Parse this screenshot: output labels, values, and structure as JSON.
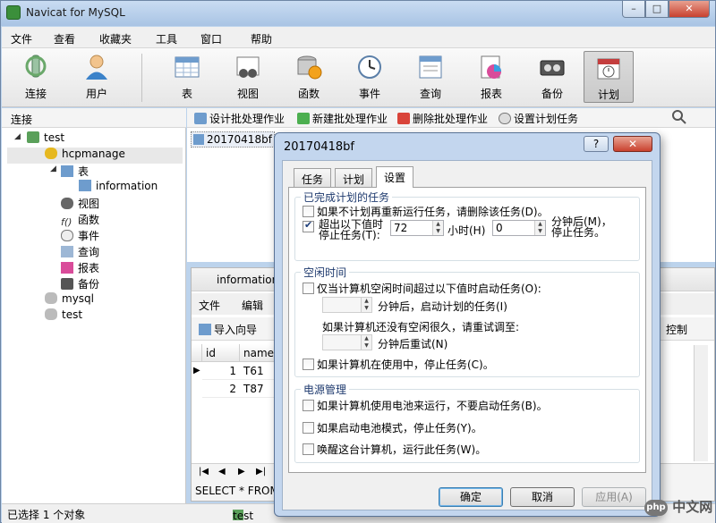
{
  "window": {
    "title": "Navicat for MySQL",
    "min": "–",
    "max": "□",
    "close": "✕"
  },
  "menu": [
    "文件",
    "查看",
    "收藏夹",
    "工具",
    "窗口",
    "帮助"
  ],
  "toolbar": {
    "connect": "连接",
    "user": "用户",
    "table": "表",
    "view": "视图",
    "function": "函数",
    "event": "事件",
    "query": "查询",
    "report": "报表",
    "backup": "备份",
    "schedule": "计划"
  },
  "left_header": "连接",
  "tree": {
    "conn1": "test",
    "db1": "hcpmanage",
    "tables": "表",
    "table1": "information",
    "views": "视图",
    "functions": "函数",
    "events": "事件",
    "queries": "查询",
    "reports": "报表",
    "backups": "备份",
    "db2": "mysql",
    "db3": "test"
  },
  "obj_toolbar": {
    "design": "设计批处理作业",
    "new": "新建批处理作业",
    "delete": "删除批处理作业",
    "set": "设置计划任务"
  },
  "obj_item": "20170418bf",
  "subwin": {
    "title": "information",
    "menu_file": "文件",
    "menu_edit": "编辑",
    "import": "导入向导",
    "right_tool": "控制",
    "columns": [
      "id",
      "name"
    ],
    "rows": [
      {
        "id": "1",
        "name": "T61"
      },
      {
        "id": "2",
        "name": "T87"
      }
    ],
    "sql": "SELECT * FROM"
  },
  "status": {
    "selected": "已选择 1 个对象",
    "db": "test"
  },
  "dialog": {
    "title": "20170418bf",
    "help": "?",
    "tabs": [
      "任务",
      "计划",
      "设置"
    ],
    "active_tab": "设置",
    "completed": {
      "title": "已完成计划的任务",
      "opt1": "如果不计划再重新运行任务，请删除该任务(D)。",
      "opt2_line1": "超出以下值时",
      "opt2_line2": "停止任务(T):",
      "opt2_checked": true,
      "hours_value": "72",
      "hours_label": "小时(H)",
      "minutes_value": "0",
      "minutes_label1": "分钟后(M)，",
      "minutes_label2": "停止任务。"
    },
    "idle": {
      "title": "空闲时间",
      "opt1": "仅当计算机空闲时间超过以下值时启动任务(O):",
      "start_after": "分钟后，启动计划的任务(I)",
      "retry_prompt": "如果计算机还没有空闲很久，请重试调至:",
      "retry_after": "分钟后重试(N)",
      "opt2": "如果计算机在使用中，停止任务(C)。"
    },
    "power": {
      "title": "电源管理",
      "opt1": "如果计算机使用电池来运行，不要启动任务(B)。",
      "opt2": "如果启动电池模式，停止任务(Y)。",
      "opt3": "唤醒这台计算机，运行此任务(W)。"
    },
    "buttons": {
      "ok": "确定",
      "cancel": "取消",
      "apply": "应用(A)"
    }
  },
  "watermark": {
    "badge": "php",
    "text": "中文网"
  }
}
